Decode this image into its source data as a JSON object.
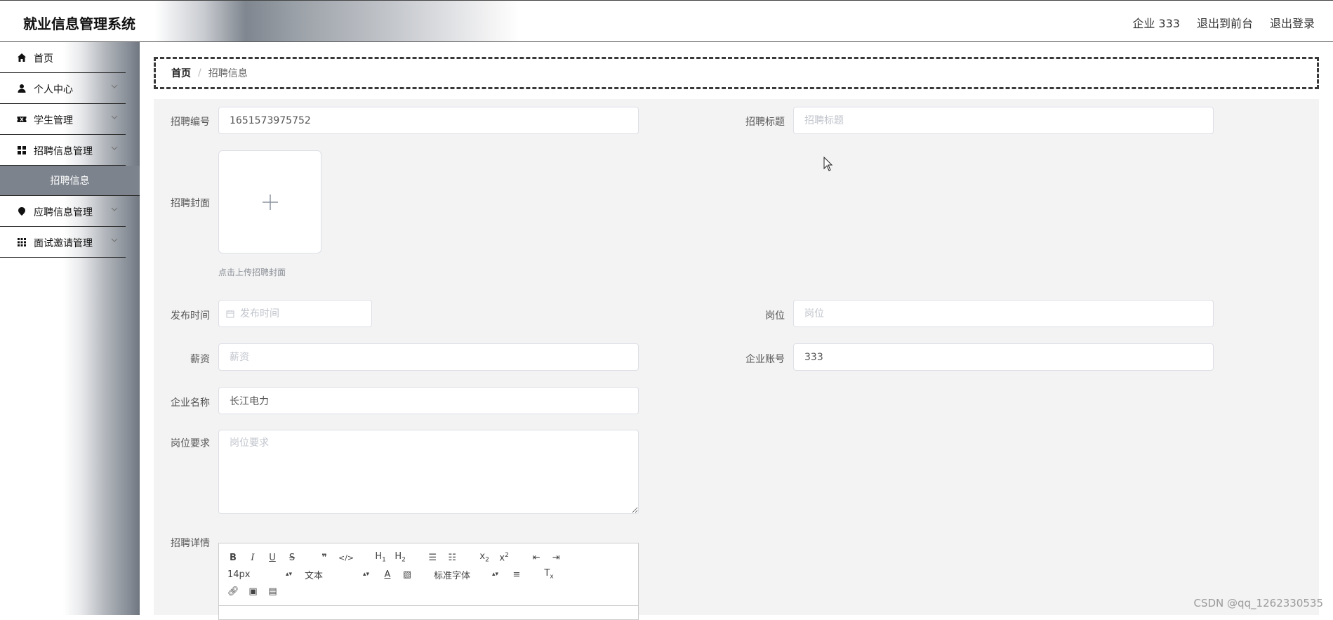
{
  "header": {
    "title": "就业信息管理系统",
    "user": "企业 333",
    "to_front": "退出到前台",
    "logout": "退出登录"
  },
  "sidebar": {
    "items": [
      {
        "label": "首页",
        "icon": "home-icon"
      },
      {
        "label": "个人中心",
        "icon": "user-icon"
      },
      {
        "label": "学生管理",
        "icon": "ticket-icon"
      },
      {
        "label": "招聘信息管理",
        "icon": "grid-icon"
      },
      {
        "label": "应聘信息管理",
        "icon": "location-pin-icon"
      },
      {
        "label": "面试邀请管理",
        "icon": "apps-icon"
      }
    ],
    "active_sub": "招聘信息"
  },
  "breadcrumb": {
    "home": "首页",
    "sep": "/",
    "current": "招聘信息"
  },
  "form": {
    "recruit_no": {
      "label": "招聘编号",
      "value": "1651573975752"
    },
    "recruit_title": {
      "label": "招聘标题",
      "placeholder": "招聘标题"
    },
    "cover": {
      "label": "招聘封面",
      "hint": "点击上传招聘封面"
    },
    "publish_time": {
      "label": "发布时间",
      "placeholder": "发布时间"
    },
    "position": {
      "label": "岗位",
      "placeholder": "岗位"
    },
    "salary": {
      "label": "薪资",
      "placeholder": "薪资"
    },
    "company_account": {
      "label": "企业账号",
      "value": "333"
    },
    "company_name": {
      "label": "企业名称",
      "value": "长江电力"
    },
    "requirements": {
      "label": "岗位要求",
      "placeholder": "岗位要求"
    },
    "details": {
      "label": "招聘详情"
    }
  },
  "editor": {
    "font_size": "14px",
    "header_select": "文本",
    "font_family": "标准字体"
  },
  "watermark": "CSDN @qq_1262330535"
}
